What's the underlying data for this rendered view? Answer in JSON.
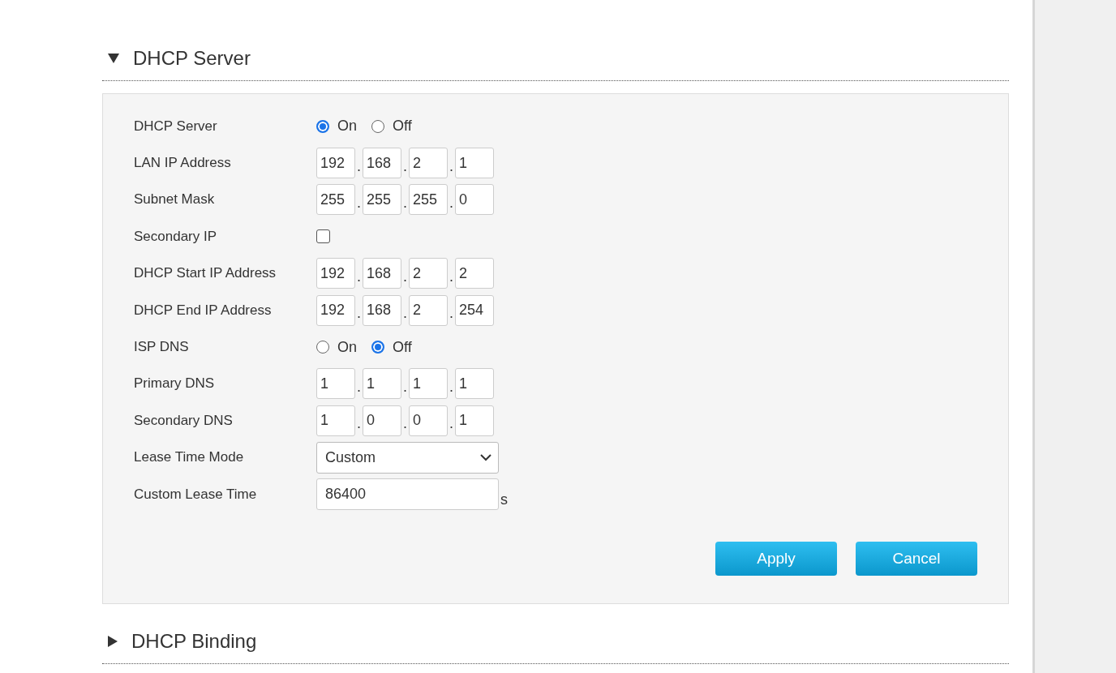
{
  "sections": [
    {
      "title": "DHCP Server",
      "expanded": true,
      "rows": [
        {
          "kind": "radio",
          "label": "DHCP Server",
          "options": [
            {
              "label": "On",
              "selected": true
            },
            {
              "label": "Off",
              "selected": false
            }
          ]
        },
        {
          "kind": "ip",
          "label": "LAN IP Address",
          "octets": [
            "192",
            "168",
            "2",
            "1"
          ],
          "separators": [
            ".",
            ".",
            "."
          ]
        },
        {
          "kind": "ip",
          "label": "Subnet Mask",
          "octets": [
            "255",
            "255",
            "255",
            "0"
          ],
          "separators": [
            ".",
            ".",
            "."
          ]
        },
        {
          "kind": "checkbox",
          "label": "Secondary IP",
          "checked": false
        },
        {
          "kind": "ip",
          "label": "DHCP Start IP Address",
          "octets": [
            "192",
            "168",
            "2",
            "2"
          ],
          "separators": [
            ".",
            ".",
            "."
          ]
        },
        {
          "kind": "ip",
          "label": "DHCP End IP Address",
          "octets": [
            "192",
            "168",
            "2",
            "254"
          ],
          "separators": [
            ".",
            ".",
            "."
          ]
        },
        {
          "kind": "radio",
          "label": "ISP DNS",
          "options": [
            {
              "label": "On",
              "selected": false
            },
            {
              "label": "Off",
              "selected": true
            }
          ]
        },
        {
          "kind": "ip",
          "label": "Primary DNS",
          "octets": [
            "1",
            "1",
            "1",
            "1"
          ],
          "separators": [
            ".",
            ".",
            "."
          ]
        },
        {
          "kind": "ip",
          "label": "Secondary DNS",
          "octets": [
            "1",
            "0",
            "0",
            "1"
          ],
          "separators": [
            ".",
            ".",
            "."
          ]
        },
        {
          "kind": "select",
          "label": "Lease Time Mode",
          "value": "Custom"
        },
        {
          "kind": "number",
          "label": "Custom Lease Time",
          "value": "86400",
          "unit": "s"
        }
      ],
      "buttons": [
        "Apply",
        "Cancel"
      ]
    },
    {
      "title": "DHCP Binding",
      "expanded": false
    }
  ]
}
